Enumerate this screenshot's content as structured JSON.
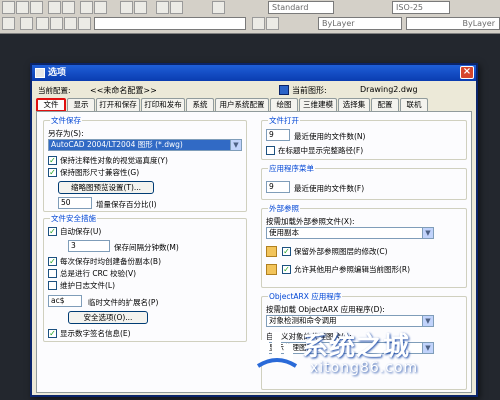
{
  "toolbar": {
    "style_combo": "Standard",
    "dim_combo": "ISO-25",
    "layer_combo": "ByLayer",
    "linetype_combo": "ByLayer"
  },
  "dialog": {
    "title": "选项",
    "profile_label": "当前配置:",
    "profile_value": "<<未命名配置>>",
    "drawing_label": "当前图形:",
    "drawing_value": "Drawing2.dwg",
    "close_glyph": "×"
  },
  "tabs": [
    "文件",
    "显示",
    "打开和保存",
    "打印和发布",
    "系统",
    "用户系统配置",
    "绘图",
    "三维建模",
    "选择集",
    "配置",
    "联机"
  ],
  "file_save": {
    "title": "文件保存",
    "saveas_label": "另存为(S):",
    "saveas_value": "AutoCAD 2004/LT2004 图形 (*.dwg)",
    "check_thumbnail": "保持注释性对象的视觉逼真度(Y)",
    "check_drawing_size": "保持图形尺寸兼容性(G)",
    "thumb_button": "缩略图预览设置(T)...",
    "incremental_value": "50",
    "incremental_label": "增量保存百分比(I)"
  },
  "file_safety": {
    "title": "文件安全措施",
    "autosave": "自动保存(U)",
    "minutes_value": "3",
    "minutes_label": "保存间隔分钟数(M)",
    "backup": "每次保存时均创建备份副本(B)",
    "crc": "总是进行 CRC 校验(V)",
    "log": "维护日志文件(L)",
    "ext_value": "ac$",
    "ext_label": "临时文件的扩展名(P)",
    "security_button": "安全选项(O)...",
    "digital_sig": "显示数字签名信息(E)"
  },
  "file_open": {
    "title": "文件打开",
    "recent_value": "9",
    "recent_label": "最近使用的文件数(N)",
    "fullpath": "在标题中显示完整路径(F)"
  },
  "app_menu": {
    "title": "应用程序菜单",
    "recent_value": "9",
    "recent_label": "最近使用的文件数(F)"
  },
  "xref": {
    "title": "外部参照",
    "demand_label": "按需加载外部参照文件(X):",
    "demand_value": "使用副本",
    "retain_changes": "保留外部参照图层的修改(C)",
    "allow_edit": "允许其他用户参照编辑当前图形(R)"
  },
  "objectarx": {
    "title": "ObjectARX 应用程序",
    "demand_label": "按需加载 ObjectARX 应用程序(D):",
    "demand_value": "对象检测和命令调用",
    "proxy_label": "自定义对象的代理图像(J):",
    "proxy_value": "显示代理图形"
  },
  "watermark": {
    "title": "系统之城",
    "url": "xitong86.com"
  }
}
